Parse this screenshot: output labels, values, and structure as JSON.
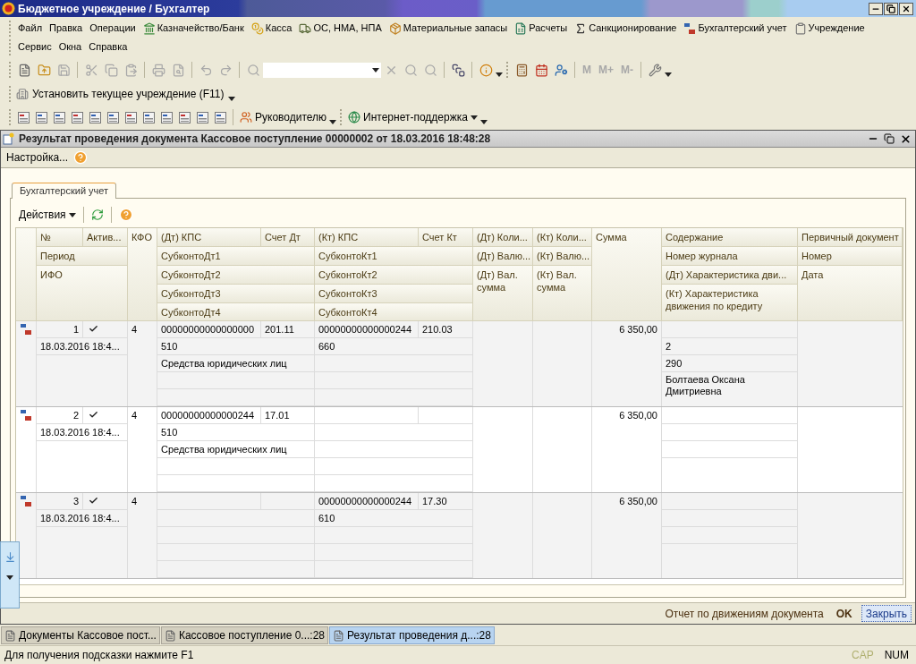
{
  "app_window": {
    "title": "Бюджетное учреждение / Бухгалтер"
  },
  "main_menu": [
    [
      {
        "label": "Файл"
      },
      {
        "label": "Правка"
      },
      {
        "label": "Операции"
      },
      {
        "label": "Казначейство/Банк"
      },
      {
        "label": "Касса"
      },
      {
        "label": "ОС, НМА, НПА"
      },
      {
        "label": "Материальные запасы"
      },
      {
        "label": "Расчеты"
      },
      {
        "label": "Санкционирование"
      },
      {
        "label": "Бухгалтерский учет"
      },
      {
        "label": "Учреждение"
      }
    ],
    [
      {
        "label": "Сервис"
      },
      {
        "label": "Окна"
      },
      {
        "label": "Справка"
      }
    ]
  ],
  "memory_buttons": [
    {
      "label": "M",
      "disabled": true
    },
    {
      "label": "M+",
      "disabled": true
    },
    {
      "label": "M-",
      "disabled": true
    }
  ],
  "institution_button": "Установить текущее учреждение (F11)",
  "report_buttons": [
    {
      "label": "Руководителю"
    },
    {
      "label": "Интернет-поддержка"
    }
  ],
  "document_window": {
    "title": "Результат проведения документа Кассовое поступление 00000002 от 18.03.2016 18:48:28",
    "settings_button": "Настройка...",
    "tabs": [
      {
        "label": "Бухгалтерский учет",
        "selected": true
      }
    ],
    "actions_button": "Действия",
    "table": {
      "header": {
        "number": "№",
        "active": "Актив...",
        "kfo": "КФО",
        "dt_kps": "(Дт) КПС",
        "dt_account": "Счет Дт",
        "kt_kps": "(Кт) КПС",
        "kt_account": "Счет Кт",
        "dt_quantity": "(Дт) Коли...",
        "kt_quantity": "(Кт) Коли...",
        "amount": "Сумма",
        "content": "Содержание",
        "primary_document": "Первичный документ",
        "period": "Период",
        "dt_subconto": [
          "СубконтоДт1",
          "СубконтоДт2",
          "СубконтоДт3",
          "СубконтоДт4"
        ],
        "kt_subconto": [
          "СубконтоКт1",
          "СубконтоКт2",
          "СубконтоКт3",
          "СубконтоКт4"
        ],
        "dt_currency": "(Дт) Валю...",
        "kt_currency": "(Кт) Валю...",
        "journal_number": "Номер журнала",
        "document_number": "Номер",
        "ifo": "ИФО",
        "dt_currency_amount": "(Дт) Вал. сумма",
        "kt_currency_amount": "(Кт) Вал. сумма",
        "dt_movement": "(Дт) Характеристика дви...",
        "document_date": "Дата",
        "kt_movement": "(Кт) Характеристика движения по кредиту"
      },
      "rows": [
        {
          "number": "1",
          "active": true,
          "period": "18.03.2016 18:4...",
          "kfo": "4",
          "dt_kps": "00000000000000000",
          "dt_account": "201.11",
          "dt_subconto": [
            "510",
            "Средства юридических лиц"
          ],
          "kt_kps": "00000000000000244",
          "kt_account": "210.03",
          "kt_subconto": [
            "660"
          ],
          "amount": "6 350,00",
          "journal_number": "2",
          "dt_movement": "290",
          "kt_movement": "Болтаева Оксана Дмитриевна"
        },
        {
          "number": "2",
          "active": true,
          "period": "18.03.2016 18:4...",
          "kfo": "4",
          "dt_kps": "00000000000000244",
          "dt_account": "17.01",
          "dt_subconto": [
            "510",
            "Средства юридических лиц"
          ],
          "amount": "6 350,00"
        },
        {
          "number": "3",
          "active": true,
          "period": "18.03.2016 18:4...",
          "kfo": "4",
          "kt_kps": "00000000000000244",
          "kt_account": "17.30",
          "kt_subconto": [
            "610"
          ],
          "amount": "6 350,00"
        }
      ]
    },
    "footer_buttons": [
      {
        "label": "Отчет по движениям документа",
        "kind": "link"
      },
      {
        "label": "OK",
        "kind": "bold"
      },
      {
        "label": "Закрыть",
        "kind": "default"
      }
    ]
  },
  "taskbar": [
    {
      "label": "Документы Кассовое пост...",
      "selected": false
    },
    {
      "label": "Кассовое поступление 0...:28",
      "selected": false
    },
    {
      "label": "Результат проведения д...:28",
      "selected": true
    }
  ],
  "status_bar": {
    "hint": "Для получения подсказки нажмите F1",
    "indicators": [
      {
        "label": "CAP",
        "on": false
      },
      {
        "label": "NUM",
        "on": true
      }
    ]
  }
}
